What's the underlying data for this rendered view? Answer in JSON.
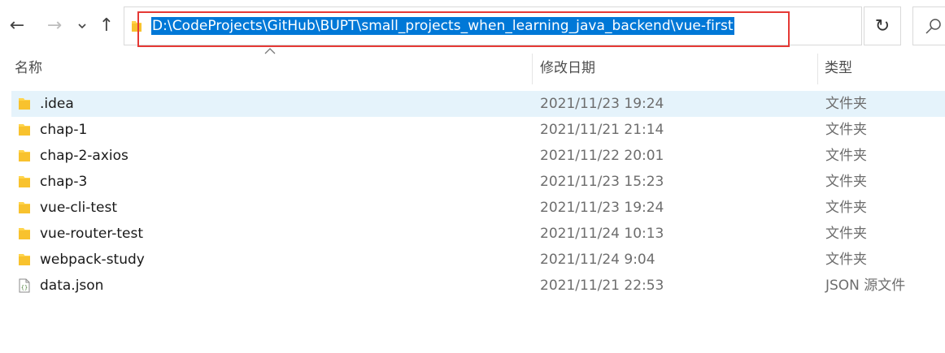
{
  "toolbar": {
    "back_icon": "←",
    "forward_icon": "→",
    "recent_icon": "⌄",
    "up_icon": "↑",
    "refresh_icon": "↻",
    "address_path": "D:\\CodeProjects\\GitHub\\BUPT\\small_projects_when_learning_java_backend\\vue-first",
    "selection_color": "#0078d7",
    "highlight_color": "#e53935"
  },
  "columns": {
    "name": "名称",
    "date": "修改日期",
    "type": "类型"
  },
  "files": [
    {
      "name": ".idea",
      "date": "2021/11/23 19:24",
      "type": "文件夹",
      "icon": "folder-icon",
      "selected": true
    },
    {
      "name": "chap-1",
      "date": "2021/11/21 21:14",
      "type": "文件夹",
      "icon": "folder-icon"
    },
    {
      "name": "chap-2-axios",
      "date": "2021/11/22 20:01",
      "type": "文件夹",
      "icon": "folder-icon"
    },
    {
      "name": "chap-3",
      "date": "2021/11/23 15:23",
      "type": "文件夹",
      "icon": "folder-icon"
    },
    {
      "name": "vue-cli-test",
      "date": "2021/11/23 19:24",
      "type": "文件夹",
      "icon": "folder-icon"
    },
    {
      "name": "vue-router-test",
      "date": "2021/11/24 10:13",
      "type": "文件夹",
      "icon": "folder-icon"
    },
    {
      "name": "webpack-study",
      "date": "2021/11/24 9:04",
      "type": "文件夹",
      "icon": "folder-icon"
    },
    {
      "name": "data.json",
      "date": "2021/11/21 22:53",
      "type": "JSON 源文件",
      "icon": "json-file-icon"
    }
  ]
}
